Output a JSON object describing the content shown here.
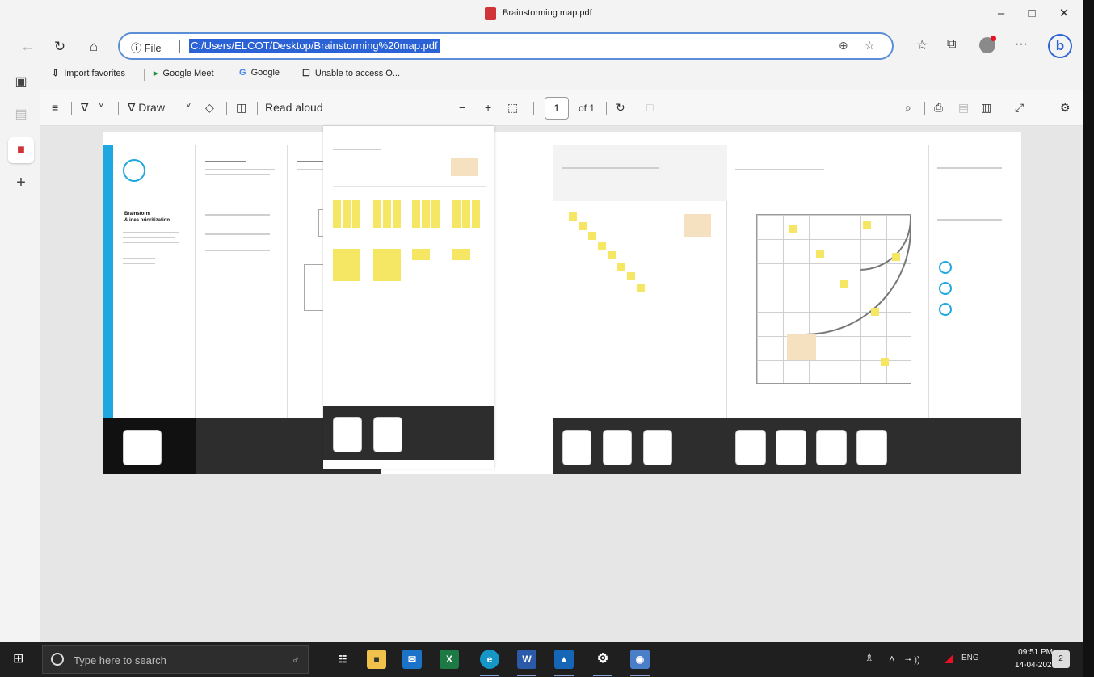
{
  "window": {
    "title": "Brainstorming map.pdf",
    "minimize": "–",
    "maximize": "□",
    "close": "✕"
  },
  "nav": {
    "back": "←",
    "refresh": "↻",
    "home": "⌂",
    "site_info": "ⓘ File",
    "url": "C:/Users/ELCOT/Desktop/Brainstorming%20map.pdf",
    "zoom_icon": "⊕",
    "read_icon": "☆",
    "fav_icon": "☆",
    "collections_icon": "⧉",
    "more": "···",
    "bing": "b"
  },
  "favorites": [
    {
      "icon": "⇩",
      "label": "Import favorites"
    },
    {
      "icon": "▸",
      "label": "Google Meet"
    },
    {
      "icon": "G",
      "label": "Google"
    },
    {
      "icon": "☐",
      "label": "Unable to access O..."
    }
  ],
  "sidebar": {
    "tabs_icon": "▣",
    "page_icon": "▤",
    "pdf_icon": "■",
    "add_icon": "+"
  },
  "pdf_toolbar": {
    "contents_icon": "≡",
    "highlight_icon": "∇",
    "dropdown": "˅",
    "draw_label": "∇  Draw",
    "eraser_icon": "◇",
    "view_icon": "◫",
    "read_aloud": "Read aloud",
    "zoom_out": "−",
    "zoom_in": "+",
    "fit_icon": "⬚",
    "page_number": "1",
    "page_of": "of 1",
    "rotate_icon": "↻",
    "spread_icon": "□",
    "search_icon": "⌕",
    "print_icon": "⎙",
    "save_icon": "▤",
    "save_as_icon": "▥",
    "fullscreen_icon": "⤢",
    "settings_icon": "⚙"
  },
  "document": {
    "title_line1": "Brainstorm",
    "title_line2": "& idea prioritization",
    "accent_color": "#1ea7e1",
    "sticky_color": "#f5e663",
    "dark_band_color": "#2d2d2d"
  },
  "taskbar": {
    "start_icon": "⊞",
    "search_placeholder": "Type here to search",
    "mic_icon": "♂",
    "apps": [
      {
        "name": "task-view",
        "label": "☷",
        "color": "#1f1f1f"
      },
      {
        "name": "file-explorer",
        "label": "■",
        "color": "#f0c14b"
      },
      {
        "name": "mail",
        "label": "✉",
        "color": "#1a73c9"
      },
      {
        "name": "excel",
        "label": "X",
        "color": "#1d7a45"
      },
      {
        "name": "edge",
        "label": "e",
        "color": "#1596c7"
      },
      {
        "name": "word",
        "label": "W",
        "color": "#2a5aa8"
      },
      {
        "name": "photos",
        "label": "▲",
        "color": "#1666b8"
      },
      {
        "name": "settings",
        "label": "⚙",
        "color": "#1f1f1f"
      },
      {
        "name": "camera",
        "label": "◉",
        "color": "#4b7ec9"
      }
    ],
    "tray_people": "♗",
    "tray_chevron": "˄",
    "tray_icons": "⭬ ))",
    "language": "ENG",
    "time": "09:51 PM",
    "date": "14-04-2023",
    "notification_count": "2"
  }
}
